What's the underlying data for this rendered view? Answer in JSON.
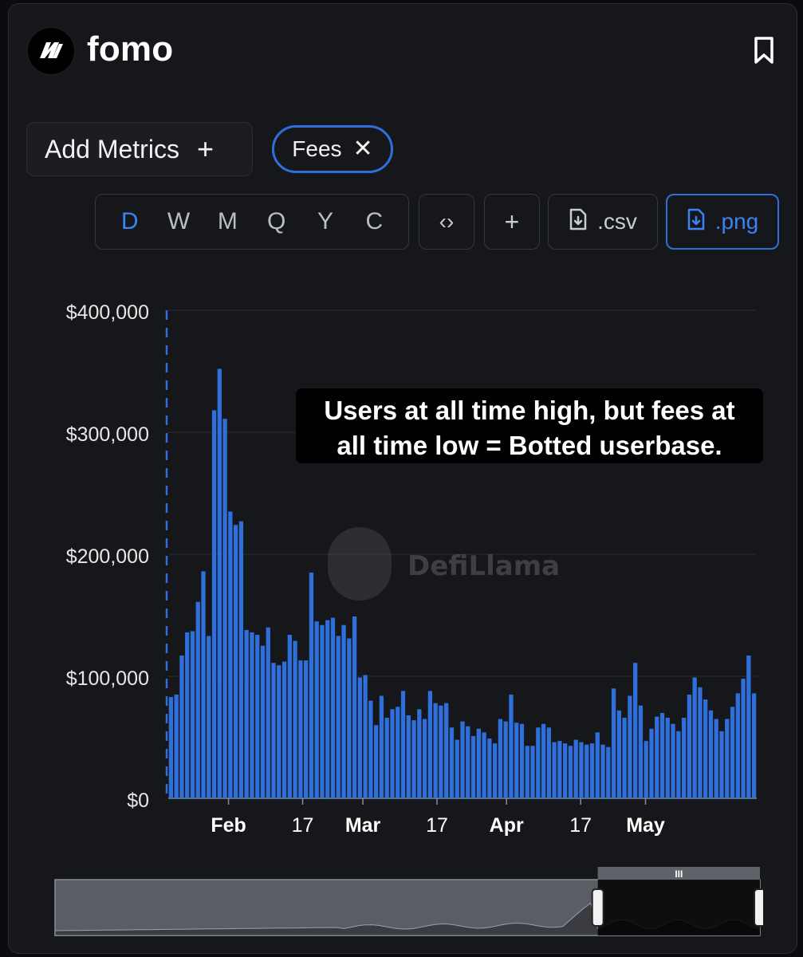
{
  "header": {
    "title": "fomo",
    "logo_icon": "fomo-logo-icon",
    "bookmark_icon": "bookmark-icon"
  },
  "metrics": {
    "add_label": "Add Metrics",
    "add_icon": "plus-icon",
    "active_metric": "Fees",
    "remove_icon": "close-icon"
  },
  "toolbar": {
    "periods": [
      "D",
      "W",
      "M",
      "Q",
      "Y",
      "C"
    ],
    "active_period": "D",
    "embed_icon": "code-icon",
    "add_icon": "plus-icon",
    "csv_label": ".csv",
    "png_label": ".png",
    "csv_icon": "file-download-icon",
    "png_icon": "file-download-icon"
  },
  "annotation": {
    "line1": "Users at all time high, but fees at",
    "line2": "all time low = Botted userbase."
  },
  "watermark": "DefiLlama",
  "colors": {
    "bar": "#2f6fdc",
    "accent": "#3b82f6",
    "background": "#16171a"
  },
  "chart_data": {
    "type": "bar",
    "x_start": "2024-01-19",
    "x_end": "2024-05-25",
    "x_ticks": [
      {
        "date": "2024-02-01",
        "label": "Feb",
        "bold": true
      },
      {
        "date": "2024-02-17",
        "label": "17",
        "bold": false
      },
      {
        "date": "2024-03-01",
        "label": "Mar",
        "bold": true
      },
      {
        "date": "2024-03-17",
        "label": "17",
        "bold": false
      },
      {
        "date": "2024-04-01",
        "label": "Apr",
        "bold": true
      },
      {
        "date": "2024-04-17",
        "label": "17",
        "bold": false
      },
      {
        "date": "2024-05-01",
        "label": "May",
        "bold": true
      }
    ],
    "y_ticks": [
      {
        "value": 0,
        "label": "$0"
      },
      {
        "value": 100000,
        "label": "$100,000"
      },
      {
        "value": 200000,
        "label": "$200,000"
      },
      {
        "value": 300000,
        "label": "$300,000"
      },
      {
        "value": 400000,
        "label": "$400,000"
      }
    ],
    "ylim": [
      0,
      400000
    ],
    "series": [
      {
        "values": [
          83000,
          85000,
          117000,
          136000,
          137000,
          161000,
          186000,
          133000,
          318000,
          352000,
          311000,
          235000,
          224000,
          227000,
          138000,
          136000,
          134000,
          125000,
          140000,
          111000,
          109000,
          112000,
          134000,
          129000,
          113000,
          113000,
          185000,
          145000,
          142000,
          146000,
          148000,
          133000,
          142000,
          131000,
          149000,
          99000,
          101000,
          80000,
          60000,
          84000,
          66000,
          73000,
          75000,
          88000,
          68000,
          64000,
          73000,
          65000,
          88000,
          78000,
          76000,
          78000,
          58000,
          48000,
          63000,
          59000,
          51000,
          57000,
          54000,
          49000,
          45000,
          65000,
          63000,
          85000,
          62000,
          61000,
          43000,
          43000,
          58000,
          61000,
          58000,
          46000,
          47000,
          45000,
          43000,
          48000,
          46000,
          44000,
          45000,
          54000,
          44000,
          42000,
          90000,
          72000,
          66000,
          84000,
          111000,
          76000,
          47000,
          57000,
          67000,
          70000,
          66000,
          61000,
          55000,
          66000,
          85000,
          99000,
          91000,
          81000,
          72000,
          65000,
          55000,
          65000,
          75000,
          86000,
          98000,
          117000,
          86000
        ]
      }
    ],
    "navigator": {
      "window_start": 0.77,
      "window_end": 1.0
    }
  }
}
